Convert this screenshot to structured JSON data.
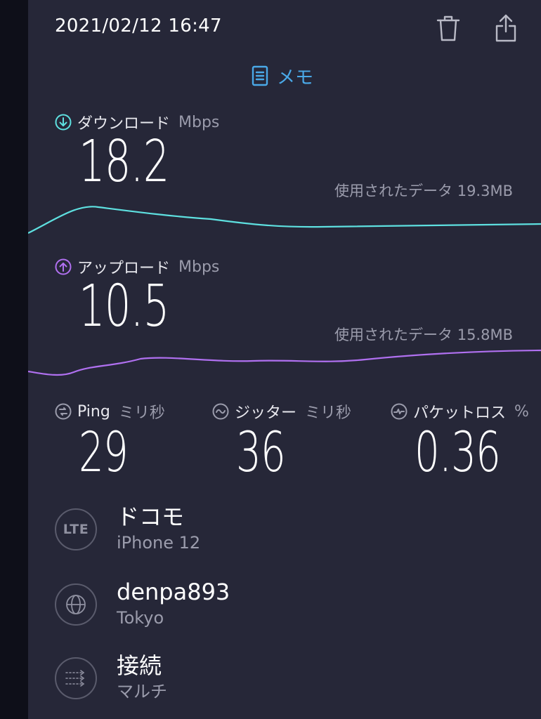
{
  "header": {
    "timestamp": "2021/02/12 16:47",
    "trash_icon": "trash-icon",
    "share_icon": "share-icon"
  },
  "memo": {
    "label": "メモ",
    "icon": "note-icon"
  },
  "download": {
    "label": "ダウンロード",
    "unit": "Mbps",
    "value": "18.2",
    "used_data_label": "使用されたデータ 19.3MB",
    "color": "#5ee0e0"
  },
  "upload": {
    "label": "アップロード",
    "unit": "Mbps",
    "value": "10.5",
    "used_data_label": "使用されたデータ 15.8MB",
    "color": "#b070f0"
  },
  "ping": {
    "label": "Ping",
    "unit": "ミリ秒",
    "value": "29"
  },
  "jitter": {
    "label": "ジッター",
    "unit": "ミリ秒",
    "value": "36"
  },
  "packet_loss": {
    "label": "パケットロス",
    "unit": "%",
    "value": "0.36"
  },
  "carrier": {
    "icon_text": "LTE",
    "name": "ドコモ",
    "device": "iPhone 12"
  },
  "server": {
    "icon": "globe-icon",
    "name": "denpa893",
    "location": "Tokyo"
  },
  "connection": {
    "icon": "multi-connection-icon",
    "label": "接続",
    "mode": "マルチ"
  }
}
